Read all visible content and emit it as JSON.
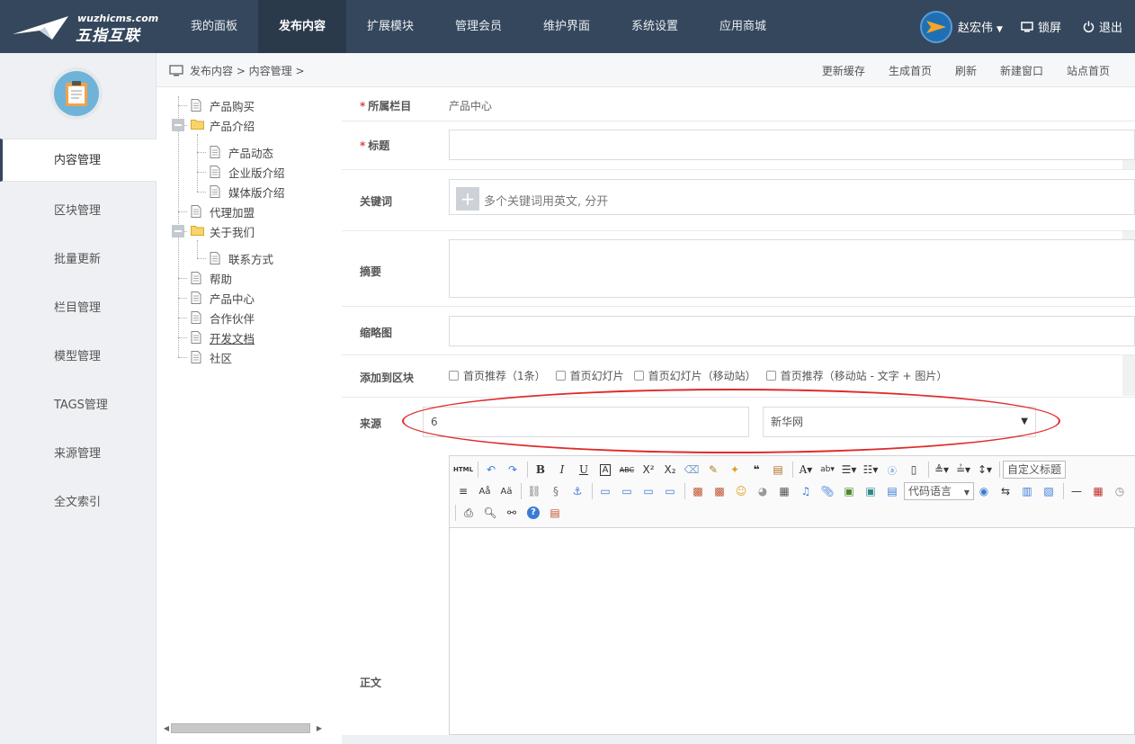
{
  "brand": {
    "domain": "wuzhicms.com",
    "name": "五指互联"
  },
  "nav": [
    {
      "label": "我的面板",
      "active": false
    },
    {
      "label": "发布内容",
      "active": true
    },
    {
      "label": "扩展模块",
      "active": false
    },
    {
      "label": "管理会员",
      "active": false
    },
    {
      "label": "维护界面",
      "active": false
    },
    {
      "label": "系统设置",
      "active": false
    },
    {
      "label": "应用商城",
      "active": false
    }
  ],
  "user": {
    "name": "赵宏伟",
    "lock_label": "锁屏",
    "logout_label": "退出"
  },
  "sidebar": {
    "items": [
      {
        "label": "内容管理",
        "active": true
      },
      {
        "label": "区块管理"
      },
      {
        "label": "批量更新"
      },
      {
        "label": "栏目管理"
      },
      {
        "label": "模型管理"
      },
      {
        "label": "TAGS管理"
      },
      {
        "label": "来源管理"
      },
      {
        "label": "全文索引"
      }
    ]
  },
  "breadcrumb": {
    "text": "发布内容 > 内容管理 >"
  },
  "actions": [
    "更新缓存",
    "生成首页",
    "刷新",
    "新建窗口",
    "站点首页"
  ],
  "tree": [
    {
      "label": "产品购买",
      "type": "page"
    },
    {
      "label": "产品介绍",
      "type": "folder"
    },
    {
      "label": "产品动态",
      "type": "page"
    },
    {
      "label": "企业版介绍",
      "type": "page"
    },
    {
      "label": "媒体版介绍",
      "type": "page"
    },
    {
      "label": "代理加盟",
      "type": "page"
    },
    {
      "label": "关于我们",
      "type": "folder"
    },
    {
      "label": "联系方式",
      "type": "page"
    },
    {
      "label": "帮助",
      "type": "page"
    },
    {
      "label": "产品中心",
      "type": "page"
    },
    {
      "label": "合作伙伴",
      "type": "page"
    },
    {
      "label": "开发文档",
      "type": "page"
    },
    {
      "label": "社区",
      "type": "page"
    }
  ],
  "form": {
    "category_label": "所属栏目",
    "category_value": "产品中心",
    "title_label": "标题",
    "keywords_label": "关键词",
    "keywords_placeholder": "多个关键词用英文, 分开",
    "summary_label": "摘要",
    "thumb_label": "缩略图",
    "block_label": "添加到区块",
    "block_options": [
      "首页推荐（1条）",
      "首页幻灯片",
      "首页幻灯片（移动站）",
      "首页推荐（移动站 - 文字 + 图片）"
    ],
    "source_label": "来源",
    "source_value": "6",
    "source_select": "新华网",
    "content_label": "正文"
  },
  "editor": {
    "html_label": "HTML",
    "custom_title": "自定义标题",
    "code_lang": "代码语言"
  },
  "colors": {
    "topbar": "#35475c",
    "highlight": "#e02a2a"
  }
}
